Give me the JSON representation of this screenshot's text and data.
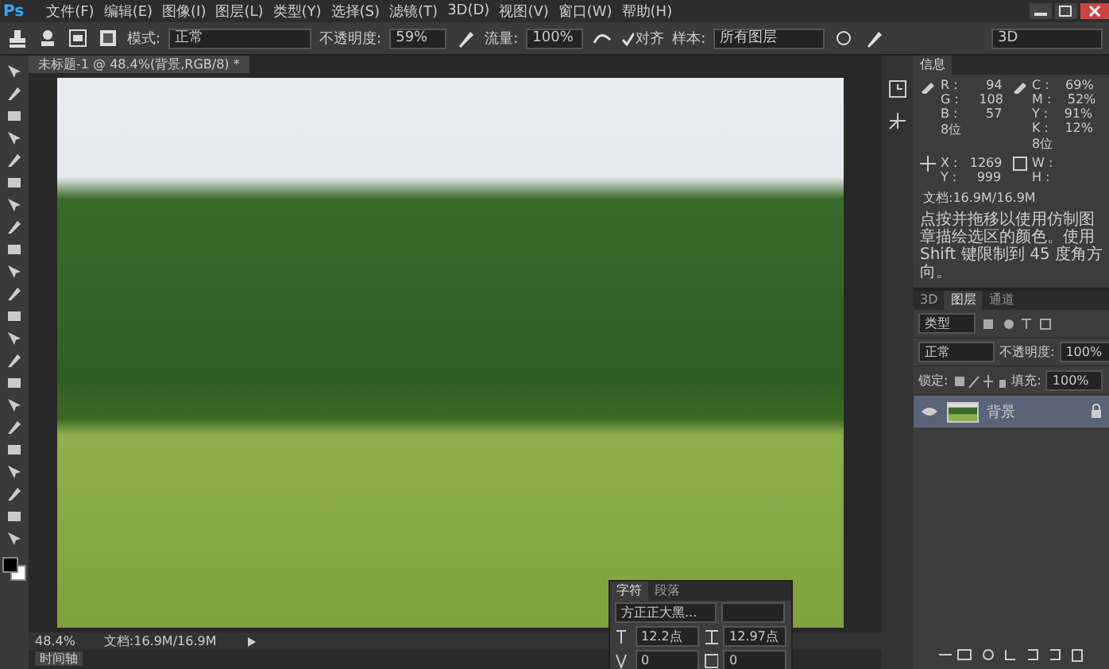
{
  "app": {
    "logo": "Ps"
  },
  "menu": [
    "文件(F)",
    "编辑(E)",
    "图像(I)",
    "图层(L)",
    "类型(Y)",
    "选择(S)",
    "滤镜(T)",
    "3D(D)",
    "视图(V)",
    "窗口(W)",
    "帮助(H)"
  ],
  "options": {
    "mode_label": "模式:",
    "mode": "正常",
    "opacity_label": "不透明度:",
    "opacity": "59%",
    "flow_label": "流量:",
    "flow": "100%",
    "aligned": {
      "label": "对齐",
      "checked": true
    },
    "sample_label": "样本:",
    "sample": "所有图层"
  },
  "workspace": "3D",
  "document_tab": {
    "title": "未标题-1 @ 48.4%(背景,RGB/8) *"
  },
  "info_panel": {
    "tab": "信息",
    "rgb": [
      {
        "label": "R :",
        "value": "94"
      },
      {
        "label": "G :",
        "value": "108"
      },
      {
        "label": "B :",
        "value": "57"
      }
    ],
    "cmyk": [
      {
        "label": "C :",
        "value": "69%"
      },
      {
        "label": "M :",
        "value": "52%"
      },
      {
        "label": "Y :",
        "value": "91%"
      },
      {
        "label": "K :",
        "value": "12%"
      }
    ],
    "bits": [
      "8位",
      "8位"
    ],
    "xy": [
      {
        "label": "X :",
        "value": "1269"
      },
      {
        "label": "Y :",
        "value": "999"
      }
    ],
    "wh": [
      "W :",
      "H :"
    ],
    "doc": "文档:16.9M/16.9M",
    "hint": "点按并拖移以使用仿制图章描绘选区的颜色。使用 Shift 键限制到 45 度角方向。"
  },
  "layers_panel": {
    "tabs": [
      {
        "label": "3D",
        "selected": false
      },
      {
        "label": "图层",
        "selected": true
      },
      {
        "label": "通道",
        "selected": false
      }
    ],
    "filter": "类型",
    "blend": "正常",
    "opacity_label": "不透明度:",
    "opacity": "100%",
    "lock_label": "锁定:",
    "fill_label": "填充:",
    "fill": "100%",
    "layers": [
      {
        "name": "背景",
        "visible": true,
        "selected": true,
        "locked": true
      }
    ]
  },
  "character_panel": {
    "tabs": [
      {
        "label": "字符",
        "selected": true
      },
      {
        "label": "段落",
        "selected": false
      }
    ],
    "font": "方正正大黑...",
    "size": "12.2点",
    "leading": "12.97点",
    "kerning": "0",
    "tracking": "0"
  },
  "status_bar": {
    "zoom": "48.4%",
    "doc": "文档:16.9M/16.9M"
  },
  "timeline_tab": "时间轴"
}
